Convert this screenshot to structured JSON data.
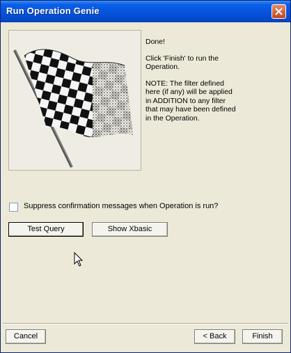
{
  "window": {
    "title": "Run Operation Genie"
  },
  "info": {
    "line1": "Done!",
    "line2": "Click 'Finish' to run the Operation.",
    "line3": "NOTE: The filter defined here (if any) will be applied in ADDITION to any filter that may have been defined in the Operation."
  },
  "options": {
    "suppress_label": "Suppress confirmation messages when Operation is run?",
    "suppress_checked": false
  },
  "buttons": {
    "test_query": "Test Query",
    "show_xbasic": "Show Xbasic",
    "cancel": "Cancel",
    "back": "< Back",
    "finish": "Finish"
  },
  "icons": {
    "close": "close-icon",
    "flag": "checkered-flag-icon",
    "cursor": "mouse-pointer-icon"
  }
}
